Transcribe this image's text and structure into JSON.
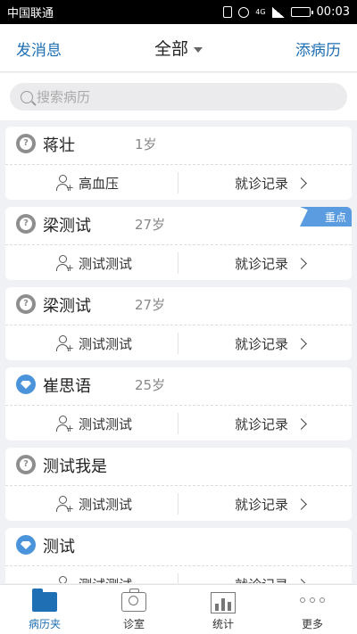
{
  "status_bar": {
    "carrier": "中国联通",
    "network": "4G",
    "time": "00:03"
  },
  "header": {
    "left_label": "发消息",
    "title": "全部",
    "right_label": "添病历"
  },
  "search": {
    "placeholder": "搜索病历"
  },
  "patients": [
    {
      "name": "蒋壮",
      "age": "1岁",
      "avatar": "question-avatar",
      "diagnosis": "高血压",
      "record_label": "就诊记录",
      "badge": ""
    },
    {
      "name": "梁测试",
      "age": "27岁",
      "avatar": "question-avatar",
      "diagnosis": "测试测试",
      "record_label": "就诊记录",
      "badge": "重点"
    },
    {
      "name": "梁测试",
      "age": "27岁",
      "avatar": "question-avatar",
      "diagnosis": "测试测试",
      "record_label": "就诊记录",
      "badge": ""
    },
    {
      "name": "崔思语",
      "age": "25岁",
      "avatar": "diamond-avatar",
      "diagnosis": "测试测试",
      "record_label": "就诊记录",
      "badge": ""
    },
    {
      "name": "测试我是",
      "age": "",
      "avatar": "question-avatar",
      "diagnosis": "测试测试",
      "record_label": "就诊记录",
      "badge": ""
    },
    {
      "name": "测试",
      "age": "",
      "avatar": "diamond-avatar",
      "diagnosis": "测试测试",
      "record_label": "就诊记录",
      "badge": ""
    }
  ],
  "tabs": [
    {
      "label": "病历夹",
      "icon": "folder-icon",
      "active": true
    },
    {
      "label": "诊室",
      "icon": "clinic-icon",
      "active": false
    },
    {
      "label": "统计",
      "icon": "chart-icon",
      "active": false
    },
    {
      "label": "更多",
      "icon": "more-icon",
      "active": false
    }
  ],
  "colors": {
    "accent": "#1e6fb4",
    "badge": "#5b9be0",
    "background": "#f0f1f5"
  }
}
